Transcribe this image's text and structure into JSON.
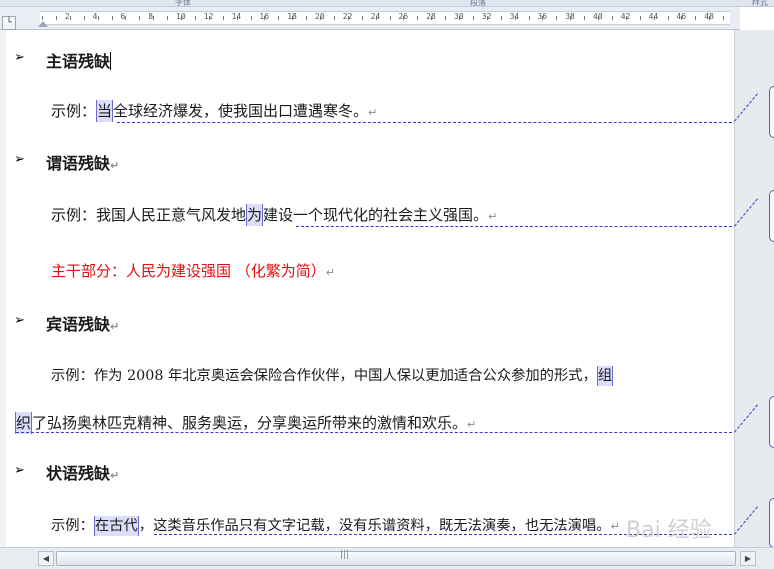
{
  "ribbon_groups": [
    "字体",
    "段落",
    "样式"
  ],
  "ruler_numbers": [
    "2",
    "4",
    "6",
    "8",
    "10",
    "12",
    "14",
    "16",
    "18",
    "20",
    "22",
    "24",
    "26",
    "28",
    "30",
    "32",
    "34",
    "36",
    "38",
    "40",
    "42",
    "44",
    "46",
    "48"
  ],
  "doc": {
    "sections": [
      {
        "heading": "主语残缺",
        "example_prefix": "示例：",
        "hl": "当",
        "rest": "全球经济爆发，使我国出口遭遇寒冬。"
      },
      {
        "heading": "谓语残缺",
        "example_prefix": "示例：",
        "before": "我国人民正意气风发地",
        "hl": "为",
        "after": "建设一个现代化的社会主义强国。",
        "note": "主干部分：人民为建设强国 （化繁为简）"
      },
      {
        "heading": "宾语残缺",
        "example_prefix": "示例：",
        "line1": "作为 2008 年北京奥运会保险合作伙伴，中国人保以更加适合公众参加的形式，",
        "hl1": "组",
        "hl2": "织",
        "line2": "了弘扬奥林匹克精神、服务奥运，分享奥运所带来的激情和欢乐。"
      },
      {
        "heading": "状语残缺",
        "example_prefix": "示例：",
        "hl": "在古代",
        "rest": "，这类音乐作品只有文字记载，没有乐谱资料，既无法演奏，也无法演唱。"
      }
    ],
    "para_mark": "↵",
    "bullet_glyph": "➢"
  },
  "watermark": "Bai 经验",
  "colors": {
    "highlight": "#dcdcfb",
    "revision_line": "#3a3acb",
    "note_red": "#e01010"
  }
}
